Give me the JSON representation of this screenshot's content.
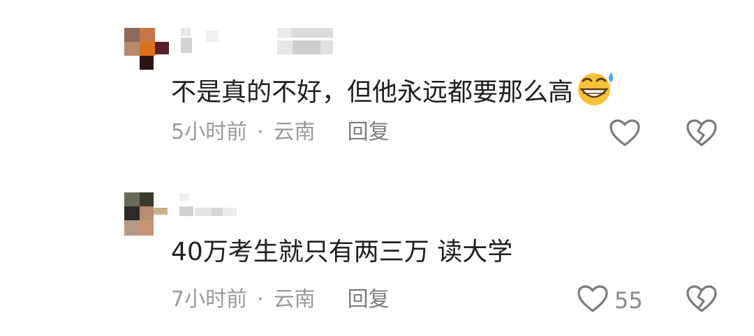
{
  "comments": [
    {
      "text": "不是真的不好，但他永远都要那么高",
      "emoji": "grinning-sweat-emoji",
      "time": "5小时前",
      "separator": "·",
      "location": "云南",
      "reply_label": "回复",
      "like_count": ""
    },
    {
      "text": "40万考生就只有两三万 读大学",
      "time": "7小时前",
      "separator": "·",
      "location": "云南",
      "reply_label": "回复",
      "like_count": "55"
    }
  ],
  "icons": {
    "like": "heart-outline-icon",
    "dislike": "broken-heart-outline-icon"
  },
  "colors": {
    "text": "#1f1f1f",
    "meta": "#9a9a9a",
    "icon": "#7a7a7a"
  }
}
